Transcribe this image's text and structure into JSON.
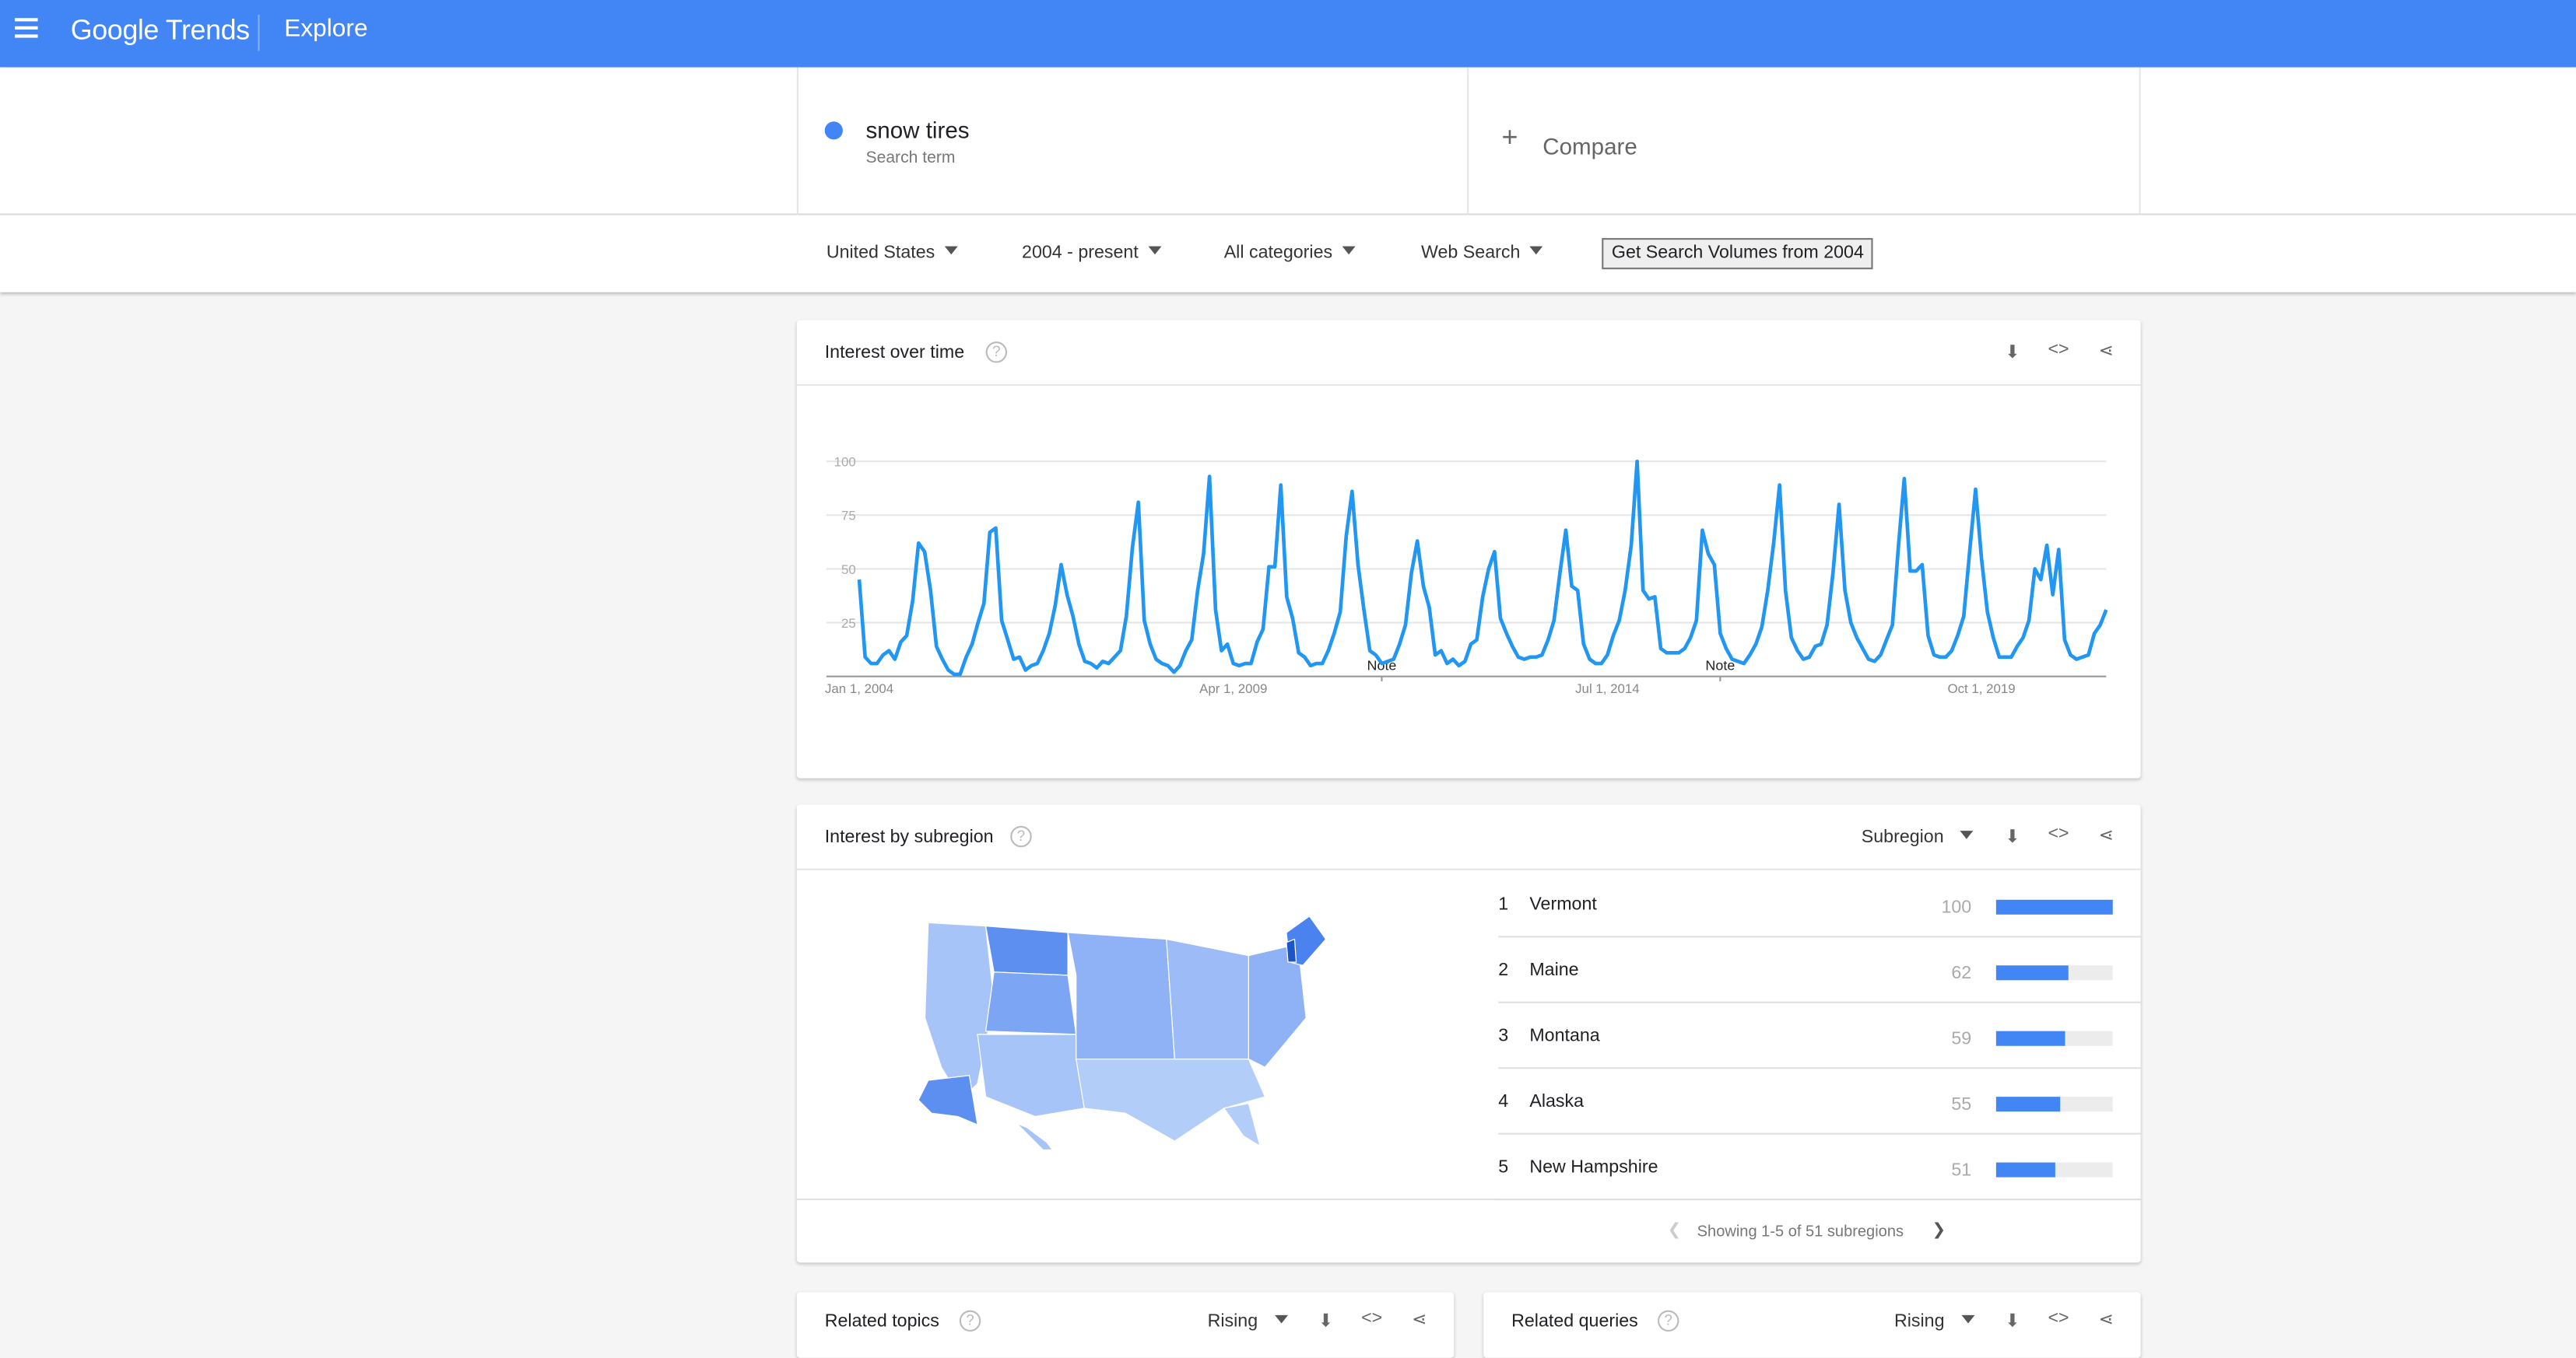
{
  "header": {
    "app_title": "Google Trends",
    "page": "Explore"
  },
  "search": {
    "term": "snow tires",
    "term_type": "Search term",
    "compare_label": "Compare",
    "term_color": "#4285f4"
  },
  "filters": {
    "region": "United States",
    "time": "2004 - present",
    "category": "All categories",
    "property": "Web Search",
    "volumes_button": "Get Search Volumes from 2004"
  },
  "interest_over_time": {
    "title": "Interest over time",
    "help": "?"
  },
  "chart_data": {
    "type": "line",
    "title": "Interest over time",
    "xlabel": "",
    "ylabel": "",
    "ylim": [
      0,
      100
    ],
    "yticks": [
      25,
      50,
      75,
      100
    ],
    "xtick_labels": [
      "Jan 1, 2004",
      "Apr 1, 2009",
      "Jul 1, 2014",
      "Oct 1, 2019"
    ],
    "xtick_index": [
      0,
      63,
      126,
      189
    ],
    "notes": [
      {
        "label": "Note",
        "index": 88
      },
      {
        "label": "Note",
        "index": 145
      }
    ],
    "series": [
      {
        "name": "snow tires",
        "color": "#2196f3",
        "start": "2004-01",
        "frequency": "monthly",
        "values": [
          45,
          9,
          6,
          6,
          10,
          12,
          8,
          16,
          19,
          35,
          62,
          58,
          40,
          14,
          8,
          3,
          1,
          1,
          9,
          15,
          25,
          34,
          67,
          69,
          26,
          17,
          8,
          9,
          3,
          5,
          6,
          12,
          20,
          33,
          52,
          38,
          28,
          15,
          7,
          6,
          4,
          7,
          6,
          9,
          12,
          28,
          60,
          81,
          26,
          15,
          8,
          6,
          5,
          2,
          5,
          12,
          17,
          40,
          57,
          93,
          31,
          12,
          15,
          6,
          5,
          6,
          6,
          16,
          22,
          51,
          51,
          89,
          37,
          27,
          11,
          9,
          5,
          6,
          6,
          12,
          20,
          30,
          65,
          86,
          52,
          31,
          12,
          10,
          6,
          7,
          8,
          15,
          24,
          48,
          63,
          42,
          32,
          10,
          12,
          6,
          8,
          5,
          7,
          15,
          17,
          37,
          50,
          58,
          27,
          20,
          14,
          9,
          8,
          9,
          9,
          10,
          17,
          26,
          48,
          68,
          42,
          40,
          15,
          8,
          6,
          6,
          10,
          19,
          26,
          40,
          61,
          100,
          40,
          36,
          37,
          13,
          11,
          11,
          11,
          13,
          18,
          26,
          68,
          57,
          52,
          20,
          13,
          8,
          7,
          6,
          10,
          15,
          23,
          40,
          62,
          89,
          40,
          18,
          12,
          8,
          9,
          14,
          15,
          24,
          48,
          80,
          40,
          25,
          18,
          13,
          8,
          7,
          10,
          17,
          24,
          60,
          92,
          49,
          49,
          52,
          19,
          10,
          9,
          9,
          12,
          19,
          28,
          58,
          87,
          55,
          30,
          18,
          9,
          9,
          9,
          14,
          18,
          26,
          50,
          45,
          61,
          38,
          59,
          17,
          10,
          8,
          9,
          10,
          20,
          24,
          31
        ]
      }
    ]
  },
  "subregion": {
    "title": "Interest by subregion",
    "help": "?",
    "dropdown": "Subregion",
    "pagination": "Showing 1-5 of 51 subregions",
    "rows": [
      {
        "rank": "1",
        "name": "Vermont",
        "value": 100
      },
      {
        "rank": "2",
        "name": "Maine",
        "value": 62
      },
      {
        "rank": "3",
        "name": "Montana",
        "value": 59
      },
      {
        "rank": "4",
        "name": "Alaska",
        "value": 55
      },
      {
        "rank": "5",
        "name": "New Hampshire",
        "value": 51
      }
    ]
  },
  "related_topics": {
    "title": "Related topics",
    "help": "?",
    "dropdown": "Rising"
  },
  "related_queries": {
    "title": "Related queries",
    "help": "?",
    "dropdown": "Rising"
  }
}
